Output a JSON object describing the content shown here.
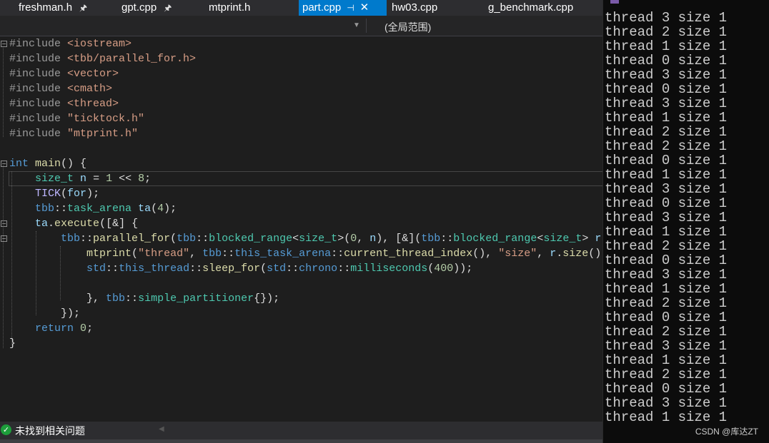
{
  "tabs": [
    {
      "label": "freshman.h",
      "pinned": true
    },
    {
      "label": "gpt.cpp",
      "pinned": true
    },
    {
      "label": "mtprint.h",
      "pinned": false
    },
    {
      "label": "part.cpp",
      "active": true
    },
    {
      "label": "hw03.cpp"
    },
    {
      "label": "g_benchmark.cpp"
    }
  ],
  "navbar": {
    "scope": "(全局范围)"
  },
  "code": {
    "inc": [
      "#include ",
      "#include ",
      "#include ",
      "#include ",
      "#include ",
      "#include ",
      "#include "
    ],
    "headers": [
      "<iostream>",
      "<tbb/parallel_for.h>",
      "<vector>",
      "<cmath>",
      "<thread>",
      "\"ticktock.h\"",
      "\"mtprint.h\""
    ]
  },
  "status": {
    "text": "未找到相关问题"
  },
  "console": {
    "lines": [
      "thread 3 size 1",
      "thread 2 size 1",
      "thread 1 size 1",
      "thread 0 size 1",
      "thread 3 size 1",
      "thread 0 size 1",
      "thread 3 size 1",
      "thread 1 size 1",
      "thread 2 size 1",
      "thread 2 size 1",
      "thread 0 size 1",
      "thread 1 size 1",
      "thread 3 size 1",
      "thread 0 size 1",
      "thread 3 size 1",
      "thread 1 size 1",
      "thread 2 size 1",
      "thread 0 size 1",
      "thread 3 size 1",
      "thread 1 size 1",
      "thread 2 size 1",
      "thread 0 size 1",
      "thread 2 size 1",
      "thread 3 size 1",
      "thread 1 size 1",
      "thread 2 size 1",
      "thread 0 size 1",
      "thread 3 size 1",
      "thread 1 size 1"
    ],
    "watermark": "CSDN @库达ZT"
  }
}
